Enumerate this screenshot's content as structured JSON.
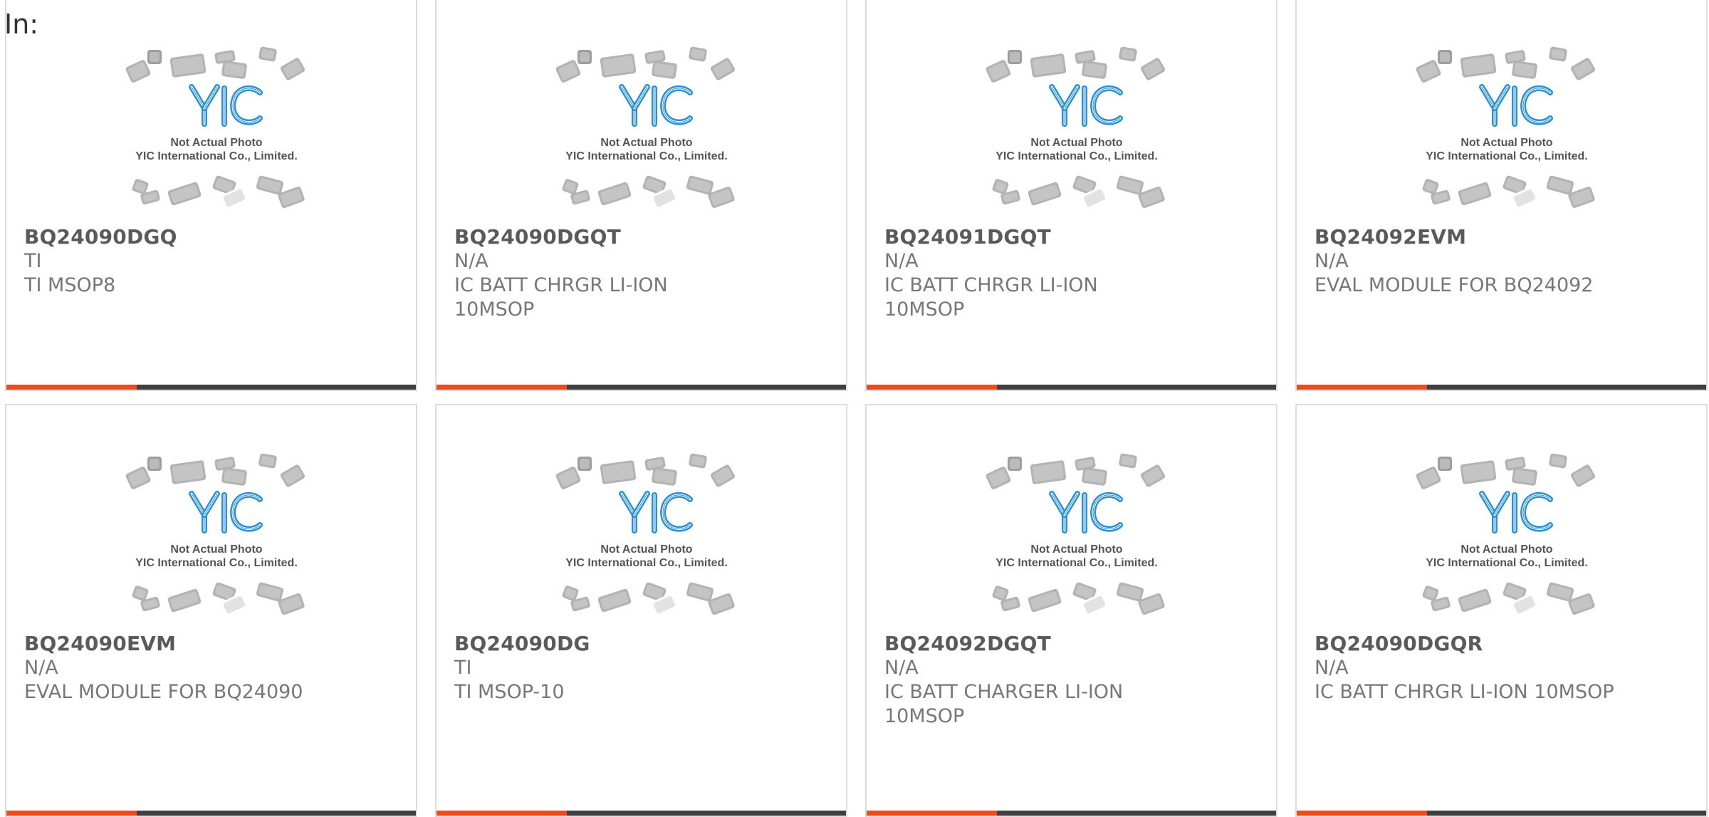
{
  "header": {
    "label": "In:"
  },
  "colors": {
    "accent": "#f04a1c",
    "bar": "#3f3f3f",
    "logo_blue": "#2b8fd0",
    "chip_gray": "#b3b3b3"
  },
  "card_image": {
    "line1": "Not Actual Photo",
    "line2": "YIC International Co., Limited.",
    "logo_text": "YIC"
  },
  "products": [
    {
      "part": "BQ24090DGQ",
      "manufacturer": "TI",
      "description": "TI MSOP8"
    },
    {
      "part": "BQ24090DGQT",
      "manufacturer": "N/A",
      "description": "IC BATT CHRGR LI-ION 10MSOP"
    },
    {
      "part": "BQ24091DGQT",
      "manufacturer": "N/A",
      "description": "IC BATT CHRGR LI-ION 10MSOP"
    },
    {
      "part": "BQ24092EVM",
      "manufacturer": "N/A",
      "description": "EVAL MODULE FOR BQ24092"
    },
    {
      "part": "BQ24090EVM",
      "manufacturer": "N/A",
      "description": "EVAL MODULE FOR BQ24090"
    },
    {
      "part": "BQ24090DG",
      "manufacturer": "TI",
      "description": "TI MSOP-10"
    },
    {
      "part": "BQ24092DGQT",
      "manufacturer": "N/A",
      "description": "IC BATT CHARGER LI-ION 10MSOP"
    },
    {
      "part": "BQ24090DGQR",
      "manufacturer": "N/A",
      "description": "IC BATT CHRGR LI-ION 10MSOP"
    }
  ]
}
